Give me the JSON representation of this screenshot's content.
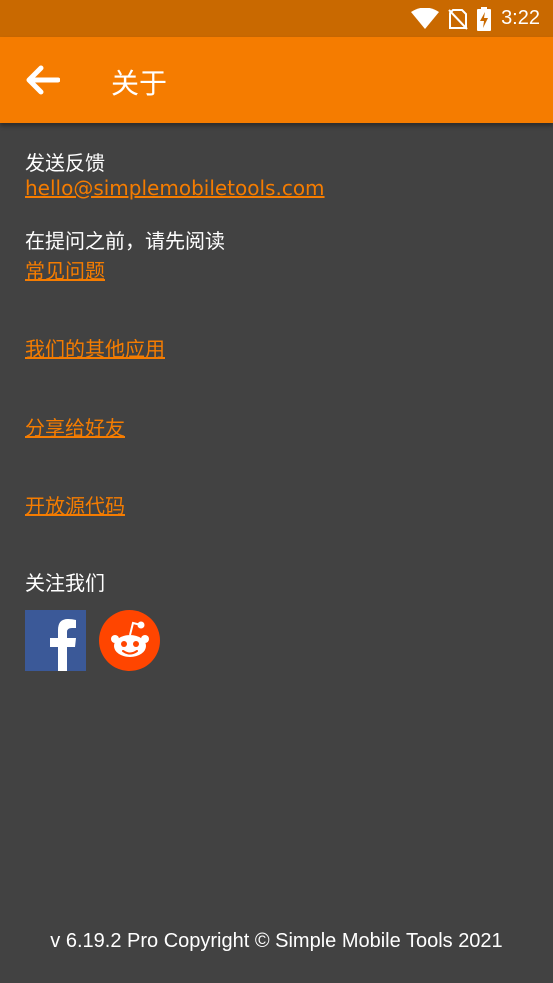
{
  "status_bar": {
    "time": "3:22",
    "icons": [
      "wifi-icon",
      "no-sim-icon",
      "battery-charging-icon"
    ]
  },
  "app_bar": {
    "title": "关于",
    "back_icon": "arrow-back-icon"
  },
  "content": {
    "email_label": "发送反馈",
    "email_link": "hello@simplemobiletools.com",
    "faq_label": "在提问之前，请先阅读",
    "faq_link": "常见问题",
    "more_apps_link": "我们的其他应用",
    "share_link": "分享给好友",
    "source_link": "开放源代码",
    "follow_label": "关注我们",
    "social": [
      "facebook-icon",
      "reddit-icon"
    ]
  },
  "footer": {
    "copyright": "v 6.19.2 Pro Copyright © Simple Mobile Tools 2021"
  },
  "colors": {
    "accent": "#f57c00",
    "status_bar": "#c96900",
    "background": "#424242"
  }
}
